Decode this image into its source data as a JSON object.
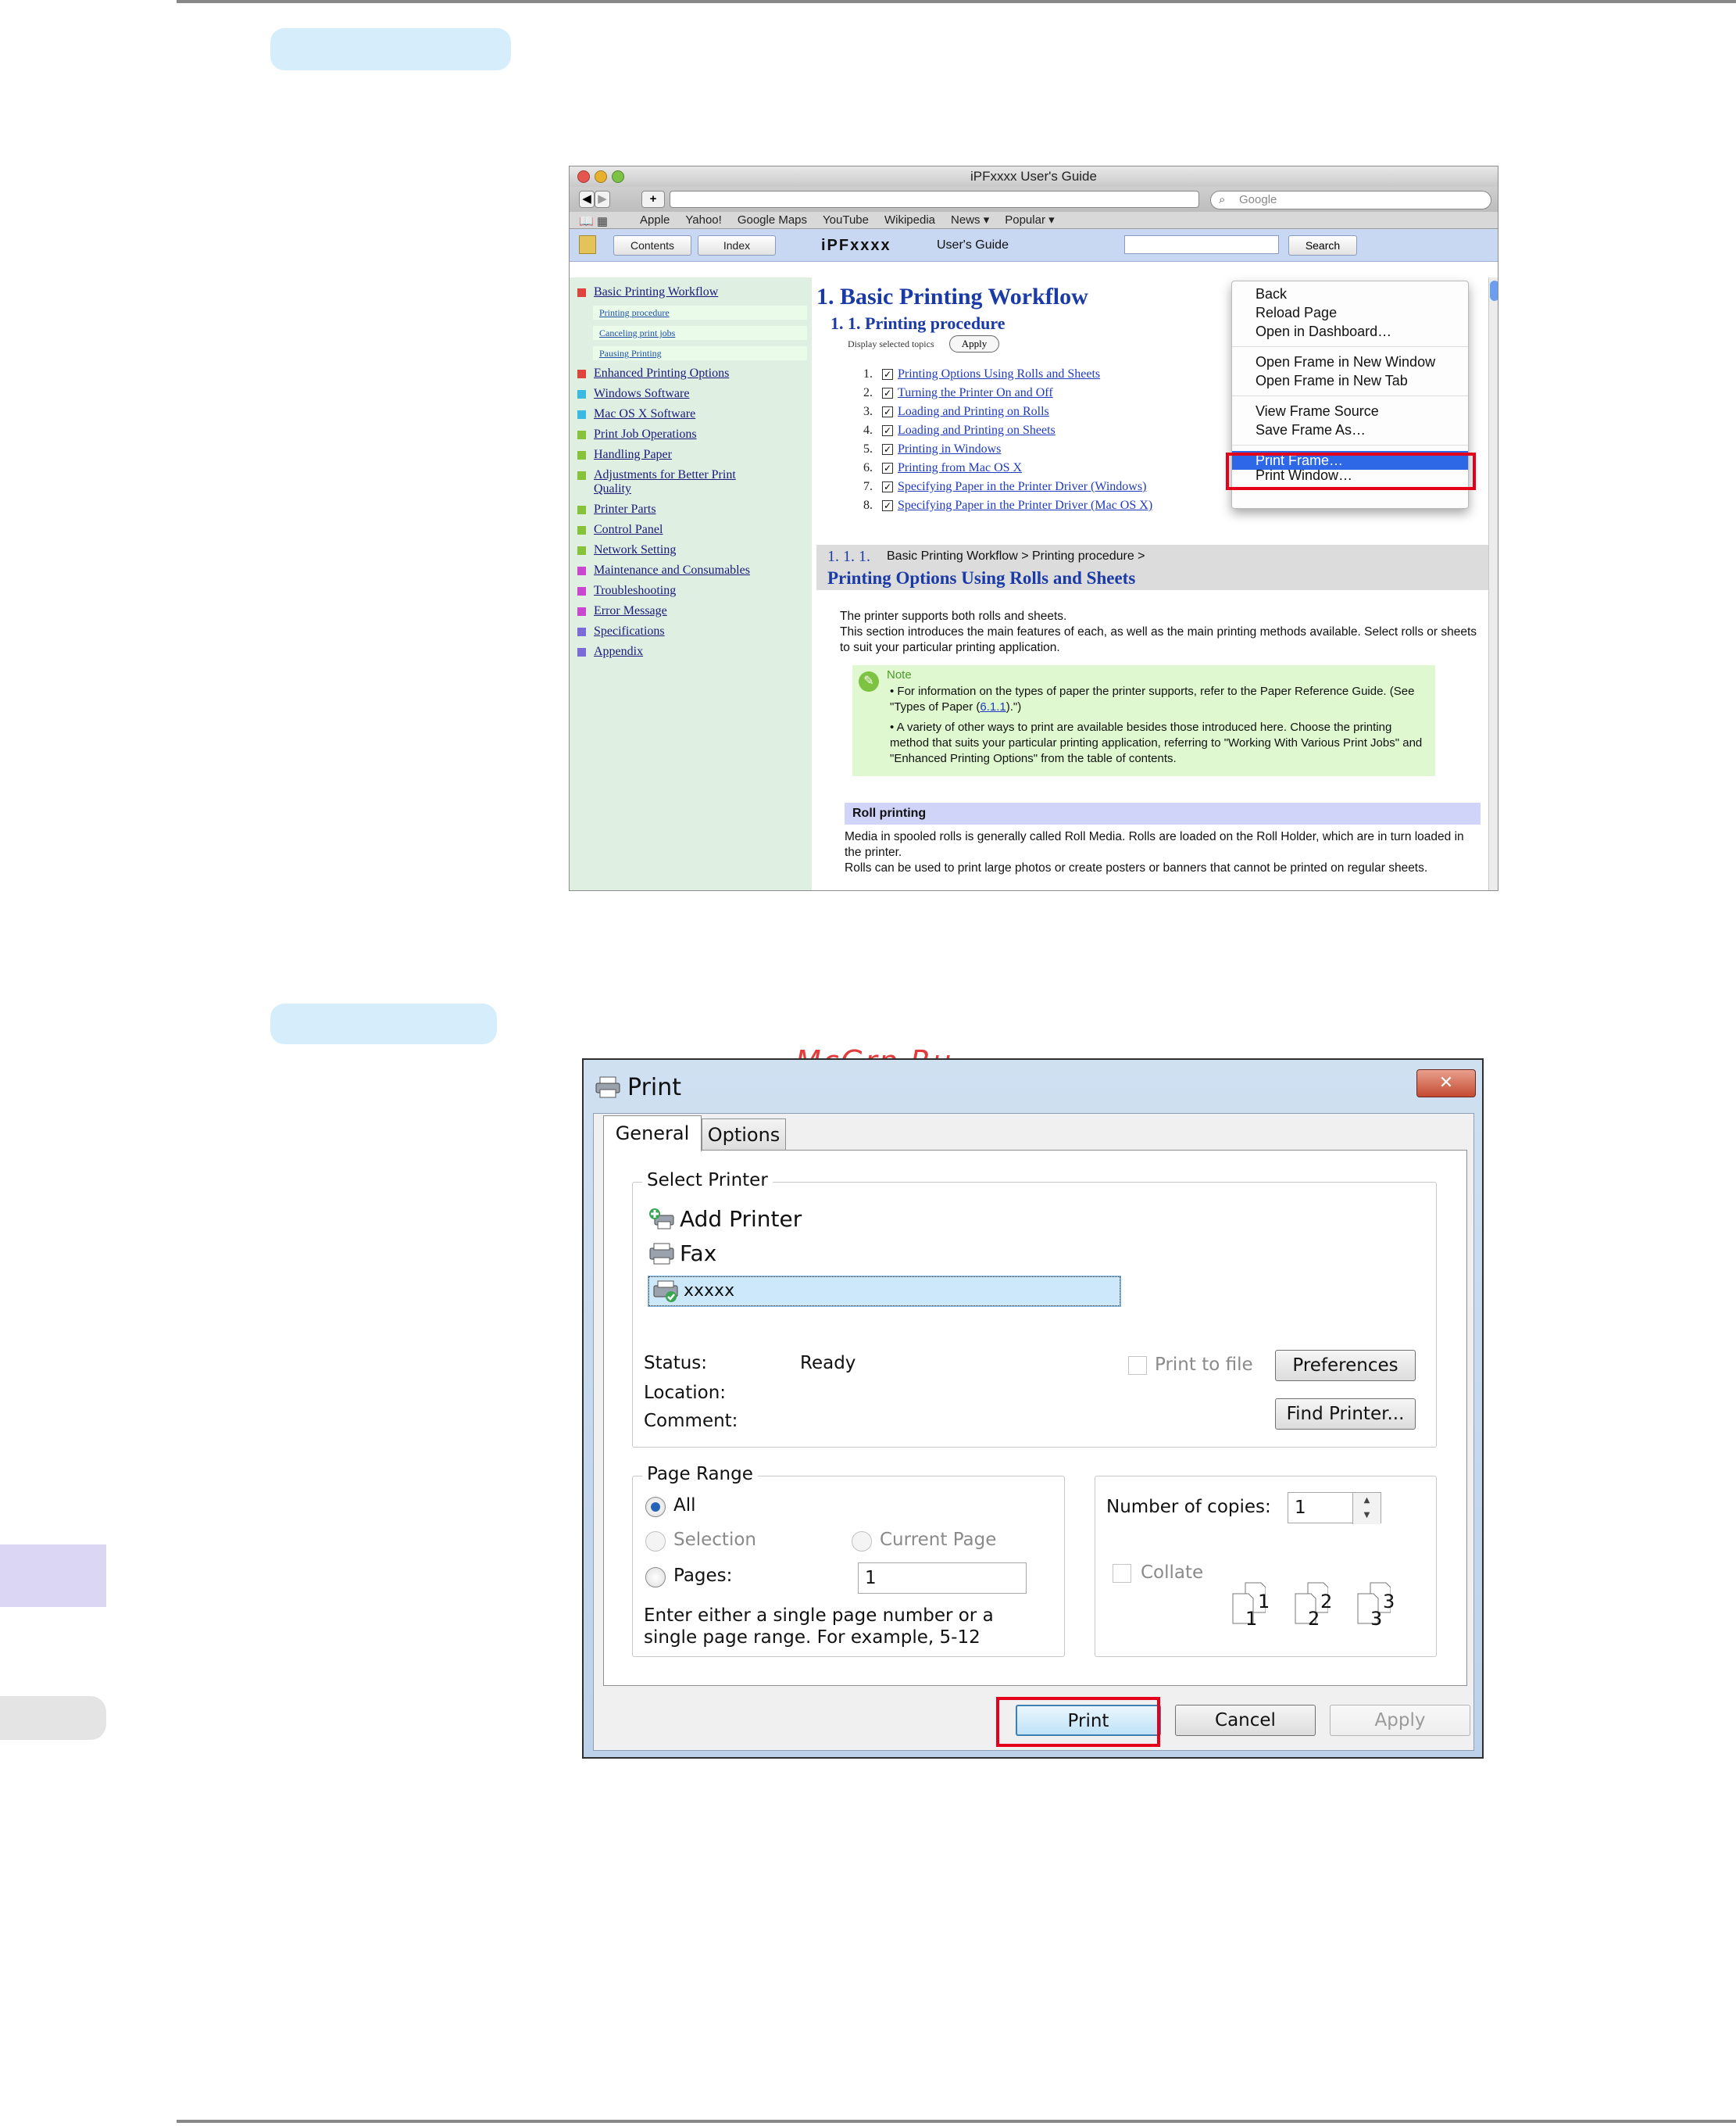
{
  "safari": {
    "window_title": "iPFxxxx User's Guide",
    "search_placeholder": "Google",
    "bookmarks": [
      "Apple",
      "Yahoo!",
      "Google Maps",
      "YouTube",
      "Wikipedia",
      "News ▾",
      "Popular ▾"
    ],
    "help_tabs": {
      "contents": "Contents",
      "index": "Index"
    },
    "help_brand": "iPFxxxx",
    "help_guide": "User's Guide",
    "help_search_button": "Search",
    "sidebar": {
      "items": [
        {
          "label": "Basic Printing Workflow",
          "color": "#e0433c"
        },
        {
          "label": "Enhanced Printing Options",
          "color": "#e0433c"
        },
        {
          "label": "Windows Software",
          "color": "#3ab9e2"
        },
        {
          "label": "Mac OS X Software",
          "color": "#3ab9e2"
        },
        {
          "label": "Print Job Operations",
          "color": "#86c23a"
        },
        {
          "label": "Handling Paper",
          "color": "#86c23a"
        },
        {
          "label": "Adjustments for Better Print Quality",
          "color": "#86c23a"
        },
        {
          "label": "Printer Parts",
          "color": "#86c23a"
        },
        {
          "label": "Control Panel",
          "color": "#86c23a"
        },
        {
          "label": "Network Setting",
          "color": "#86c23a"
        },
        {
          "label": "Maintenance and Consumables",
          "color": "#cc47cf"
        },
        {
          "label": "Troubleshooting",
          "color": "#cc47cf"
        },
        {
          "label": "Error Message",
          "color": "#cc47cf"
        },
        {
          "label": "Specifications",
          "color": "#7a6bd8"
        },
        {
          "label": "Appendix",
          "color": "#7a6bd8"
        }
      ],
      "subitems": [
        "Printing procedure",
        "Canceling print jobs",
        "Pausing Printing"
      ]
    },
    "content": {
      "h1": "1. Basic Printing Workflow",
      "h2": "1. 1. Printing procedure",
      "display_selected": "Display selected topics",
      "apply": "Apply",
      "topics": [
        {
          "num": "1.",
          "label": "Printing Options Using Rolls and Sheets"
        },
        {
          "num": "2.",
          "label": "Turning the Printer On and Off"
        },
        {
          "num": "3.",
          "label": "Loading and Printing on Rolls"
        },
        {
          "num": "4.",
          "label": "Loading and Printing on Sheets"
        },
        {
          "num": "5.",
          "label": "Printing in Windows"
        },
        {
          "num": "6.",
          "label": "Printing from Mac OS X"
        },
        {
          "num": "7.",
          "label": "Specifying Paper in the Printer Driver (Windows)"
        },
        {
          "num": "8.",
          "label": "Specifying Paper in the Printer Driver (Mac OS X)"
        }
      ],
      "section_number": "1. 1. 1.",
      "section_breadcrumb": "Basic Printing Workflow > Printing procedure >",
      "section_title": "Printing Options Using Rolls and Sheets",
      "intro_1": "The printer supports both rolls and sheets.",
      "intro_2": "This section introduces the main features of each, as well as the main printing methods available. Select rolls or sheets to suit your particular printing application.",
      "note_label": "Note",
      "note_1a": "For information on the types of paper the printer supports, refer to the Paper Reference Guide.  (See \"Types of Paper (",
      "note_1_link": "6.1.1",
      "note_1b": ").\")",
      "note_2": "A variety of other ways to print are available besides those introduced here. Choose the printing method that suits your particular printing application, referring to \"Working With Various Print Jobs\" and \"Enhanced Printing Options\" from the table of contents.",
      "roll_heading": "Roll printing",
      "roll_1": "Media in spooled rolls is generally called Roll Media. Rolls are loaded on the Roll Holder, which are in turn loaded in the printer.",
      "roll_2": "Rolls can be used to print large photos or create posters or banners that cannot be printed on regular sheets."
    },
    "context_menu": {
      "back": "Back",
      "reload": "Reload Page",
      "dashboard": "Open in Dashboard…",
      "new_window": "Open Frame in New Window",
      "new_tab": "Open Frame in New Tab",
      "view_source": "View Frame Source",
      "save_as": "Save Frame As…",
      "print_frame": "Print Frame…",
      "print_window": "Print Window…"
    }
  },
  "watermark": "McGrp.Ru",
  "print_dialog": {
    "title": "Print",
    "tabs": {
      "general": "General",
      "options": "Options"
    },
    "select_printer_label": "Select Printer",
    "printers": [
      "Add Printer",
      "Fax",
      "xxxxx"
    ],
    "status_label": "Status:",
    "status_value": "Ready",
    "location_label": "Location:",
    "comment_label": "Comment:",
    "print_to_file": "Print to file",
    "preferences": "Preferences",
    "find_printer": "Find Printer...",
    "page_range_label": "Page Range",
    "all": "All",
    "selection": "Selection",
    "current_page": "Current Page",
    "pages": "Pages:",
    "pages_value": "1",
    "hint": "Enter either a single page number or a single page range.  For example, 5-12",
    "copies_label": "Number of copies:",
    "copies_value": "1",
    "collate": "Collate",
    "collate_pages": [
      "1",
      "1",
      "2",
      "2",
      "3",
      "3"
    ],
    "print": "Print",
    "cancel": "Cancel",
    "apply": "Apply"
  }
}
